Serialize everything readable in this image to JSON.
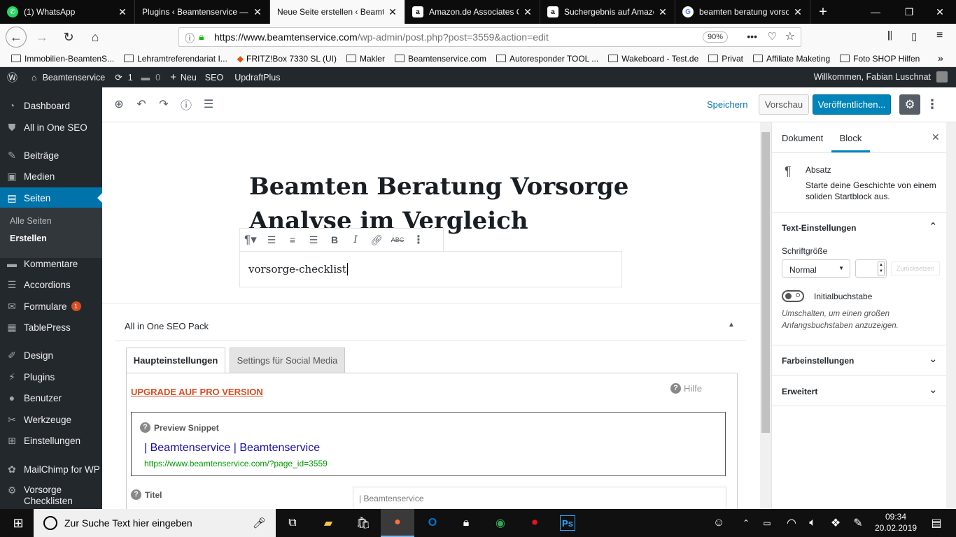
{
  "browser": {
    "tabs": [
      {
        "title": "(1) WhatsApp",
        "fav": "whatsapp-icon",
        "color": "#25d366"
      },
      {
        "title": "Plugins ‹ Beamtenservice — WordPress",
        "fav": "wordpress-icon",
        "color": "#464646"
      },
      {
        "title": "Neue Seite erstellen ‹ Beamtenservice",
        "fav": "wordpress-icon",
        "color": "#464646"
      },
      {
        "title": "Amazon.de Associates Central",
        "fav": "amazon-icon",
        "color": "#232f3e"
      },
      {
        "title": "Suchergebnis auf Amazon.de",
        "fav": "amazon-icon",
        "color": "#232f3e"
      },
      {
        "title": "beamten beratung vorsorge",
        "fav": "google-icon",
        "color": "#4285f4"
      }
    ],
    "active_tab": 2,
    "url_host": "https://www.beamtenservice.com",
    "url_path": "/wp-admin/post.php?post=3559&action=edit",
    "zoom": "90%",
    "bookmarks": [
      "Immobilien-BeamtenS...",
      "Lehramtreferendariat I...",
      "FRITZ!Box 7330 SL (UI)",
      "Makler",
      "Beamtenservice.com",
      "Autoresponder TOOL ...",
      "Wakeboard - Test.de",
      "Privat",
      "Affiliate Maketing",
      "Foto SHOP Hilfen"
    ]
  },
  "adminbar": {
    "site": "Beamtenservice",
    "updates": "1",
    "comments": "0",
    "new": "Neu",
    "seo": "SEO",
    "updraft": "UpdraftPlus",
    "greeting": "Willkommen, Fabian Luschnat"
  },
  "menu": {
    "dashboard": "Dashboard",
    "aioseo": "All in One SEO",
    "posts": "Beiträge",
    "media": "Medien",
    "pages": "Seiten",
    "all_pages": "Alle Seiten",
    "create": "Erstellen",
    "comments": "Kommentare",
    "accordions": "Accordions",
    "forms": "Formulare",
    "forms_badge": "1",
    "tablepress": "TablePress",
    "design": "Design",
    "plugins": "Plugins",
    "users": "Benutzer",
    "tools": "Werkzeuge",
    "settings": "Einstellungen",
    "mailchimp": "MailChimp for WP",
    "vorsorge1": "Vorsorge",
    "vorsorge2": "Checklisten"
  },
  "editor": {
    "save": "Speichern",
    "preview": "Vorschau",
    "publish": "Veröffentlichen...",
    "title": "Beamten Beratung Vorsorge Analyse im Vergleich",
    "paragraph": "vorsorge-checklist"
  },
  "seo": {
    "header": "All in One SEO Pack",
    "tab_main": "Haupteinstellungen",
    "tab_social": "Settings für Social Media",
    "upgrade": "UPGRADE AUF PRO VERSION",
    "help": "Hilfe",
    "preview_label": "Preview Snippet",
    "snippet_title": "| Beamtenservice | Beamtenservice",
    "snippet_url": "https://www.beamtenservice.com/?page_id=3559",
    "title_label": "Titel",
    "title_value": "| Beamtenservice"
  },
  "panel": {
    "tab_doc": "Dokument",
    "tab_block": "Block",
    "block_name": "Absatz",
    "block_desc": "Starte deine Geschichte von einem soliden Startblock aus.",
    "text_settings": "Text-Einstellungen",
    "font_size": "Schriftgröße",
    "font_size_value": "Normal",
    "reset": "Zurücksetzen",
    "dropcap": "Initialbuchstabe",
    "dropcap_help": "Umschalten, um einen großen Anfangsbuchstaben anzuzeigen.",
    "color_settings": "Farbeinstellungen",
    "advanced": "Erweitert"
  },
  "taskbar": {
    "search": "Zur Suche Text hier eingeben",
    "time": "09:34",
    "date": "20.02.2019"
  },
  "colors": {
    "wp_dark": "#23282d",
    "wp_blue": "#0073aa",
    "publish": "#0085ba",
    "upgrade": "#d54e21",
    "snippet_title": "#1a0dab",
    "snippet_url": "#009900"
  }
}
